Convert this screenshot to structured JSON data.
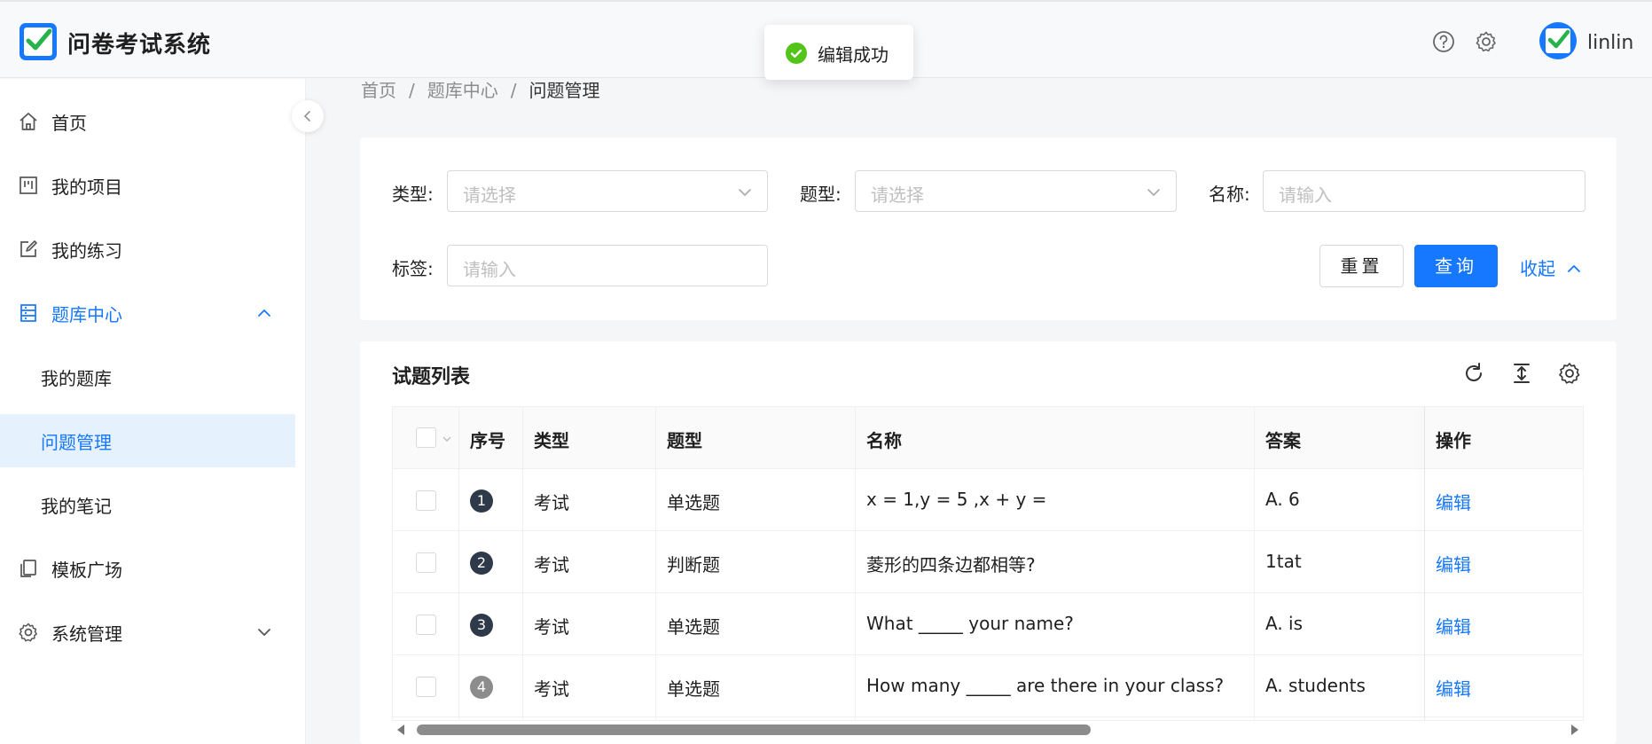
{
  "app": {
    "title": "问卷考试系统",
    "username": "linlin"
  },
  "toast": {
    "message": "编辑成功"
  },
  "sidebar": {
    "items": [
      {
        "label": "首页",
        "icon": "home-icon"
      },
      {
        "label": "我的项目",
        "icon": "project-icon"
      },
      {
        "label": "我的练习",
        "icon": "edit-icon"
      },
      {
        "label": "题库中心",
        "icon": "database-icon",
        "expanded": true
      },
      {
        "label": "我的题库"
      },
      {
        "label": "问题管理",
        "active": true
      },
      {
        "label": "我的笔记"
      },
      {
        "label": "模板广场",
        "icon": "copy-icon"
      },
      {
        "label": "系统管理",
        "icon": "gear-icon",
        "expanded": false
      }
    ]
  },
  "breadcrumb": {
    "items": [
      "首页",
      "题库中心",
      "问题管理"
    ],
    "sep": "/"
  },
  "filters": {
    "type_label": "类型:",
    "type_placeholder": "请选择",
    "qtype_label": "题型:",
    "qtype_placeholder": "请选择",
    "name_label": "名称:",
    "name_placeholder": "请输入",
    "tag_label": "标签:",
    "tag_placeholder": "请输入",
    "reset_label": "重置",
    "query_label": "查询",
    "collapse_label": "收起"
  },
  "table": {
    "title": "试题列表",
    "columns": [
      "序号",
      "类型",
      "题型",
      "名称",
      "答案",
      "操作"
    ],
    "rows": [
      {
        "seq": "1",
        "type": "考试",
        "qtype": "单选题",
        "name": "x = 1,y = 5 ,x + y =",
        "answer": "A. 6",
        "action": "编辑"
      },
      {
        "seq": "2",
        "type": "考试",
        "qtype": "判断题",
        "name": "菱形的四条边都相等?",
        "answer": "1tat",
        "action": "编辑"
      },
      {
        "seq": "3",
        "type": "考试",
        "qtype": "单选题",
        "name": "What _____ your name?",
        "answer": "A. is",
        "action": "编辑"
      },
      {
        "seq": "4",
        "type": "考试",
        "qtype": "单选题",
        "name": "How many _____ are there in your class?",
        "answer": "A. students",
        "action": "编辑"
      }
    ]
  },
  "colors": {
    "primary": "#1677ff",
    "success": "#52c41a",
    "seq_dark": "#2e3a4a",
    "seq_gray": "#8c8c8c"
  }
}
